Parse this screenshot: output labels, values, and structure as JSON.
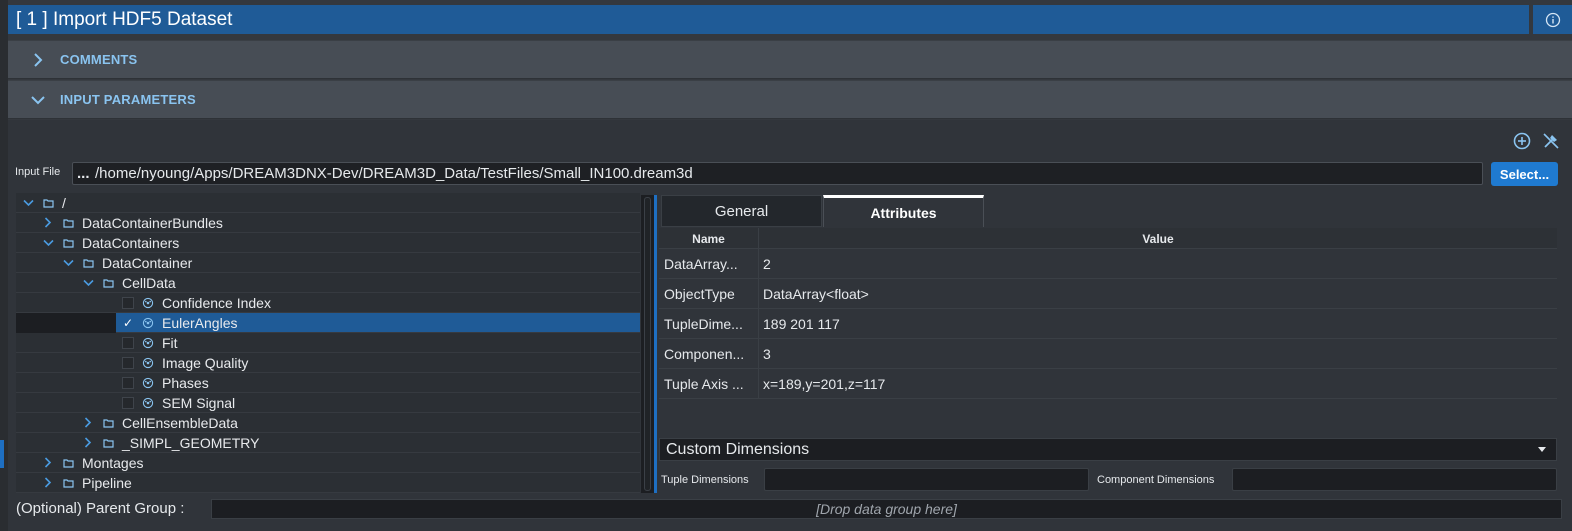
{
  "title": "[ 1 ] Import HDF5 Dataset",
  "sections": {
    "comments": "COMMENTS",
    "input_parameters": "INPUT PARAMETERS"
  },
  "input_file": {
    "label": "Input File",
    "ellipsis": "...",
    "path": "/home/nyoung/Apps/DREAM3DNX-Dev/DREAM3D_Data/TestFiles/Small_IN100.dream3d",
    "select_label": "Select..."
  },
  "tree": [
    {
      "label": "/",
      "level": 0,
      "expanded": true,
      "type": "folder"
    },
    {
      "label": "DataContainerBundles",
      "level": 1,
      "expanded": false,
      "type": "folder"
    },
    {
      "label": "DataContainers",
      "level": 1,
      "expanded": true,
      "type": "folder"
    },
    {
      "label": "DataContainer",
      "level": 2,
      "expanded": true,
      "type": "folder"
    },
    {
      "label": "CellData",
      "level": 3,
      "expanded": true,
      "type": "folder"
    },
    {
      "label": "Confidence Index",
      "level": 4,
      "type": "dataset",
      "checked": false
    },
    {
      "label": "EulerAngles",
      "level": 4,
      "type": "dataset",
      "checked": true,
      "selected": true
    },
    {
      "label": "Fit",
      "level": 4,
      "type": "dataset",
      "checked": false
    },
    {
      "label": "Image Quality",
      "level": 4,
      "type": "dataset",
      "checked": false
    },
    {
      "label": "Phases",
      "level": 4,
      "type": "dataset",
      "checked": false
    },
    {
      "label": "SEM Signal",
      "level": 4,
      "type": "dataset",
      "checked": false
    },
    {
      "label": "CellEnsembleData",
      "level": 3,
      "expanded": false,
      "type": "folder"
    },
    {
      "label": "_SIMPL_GEOMETRY",
      "level": 3,
      "expanded": false,
      "type": "folder"
    },
    {
      "label": "Montages",
      "level": 1,
      "expanded": false,
      "type": "folder"
    },
    {
      "label": "Pipeline",
      "level": 1,
      "expanded": false,
      "type": "folder"
    }
  ],
  "tabs": {
    "general": "General",
    "attributes": "Attributes",
    "active": "attributes"
  },
  "attributes": {
    "headers": {
      "name": "Name",
      "value": "Value"
    },
    "rows": [
      {
        "name": "DataArray...",
        "value": "2"
      },
      {
        "name": "ObjectType",
        "value": "DataArray<float>"
      },
      {
        "name": "TupleDime...",
        "value": "189 201 117"
      },
      {
        "name": "Componen...",
        "value": "3"
      },
      {
        "name": "Tuple Axis ...",
        "value": "x=189,y=201,z=117"
      }
    ]
  },
  "custom_dimensions": {
    "selected": "Custom Dimensions",
    "tuple_label": "Tuple Dimensions",
    "tuple_value": "",
    "component_label": "Component Dimensions",
    "component_value": ""
  },
  "parent_group": {
    "label": "(Optional) Parent Group :",
    "placeholder": "[Drop data group here]"
  },
  "colors": {
    "accent": "#1f5b97",
    "button": "#1f7ad0",
    "section_text": "#8ac4f0"
  }
}
